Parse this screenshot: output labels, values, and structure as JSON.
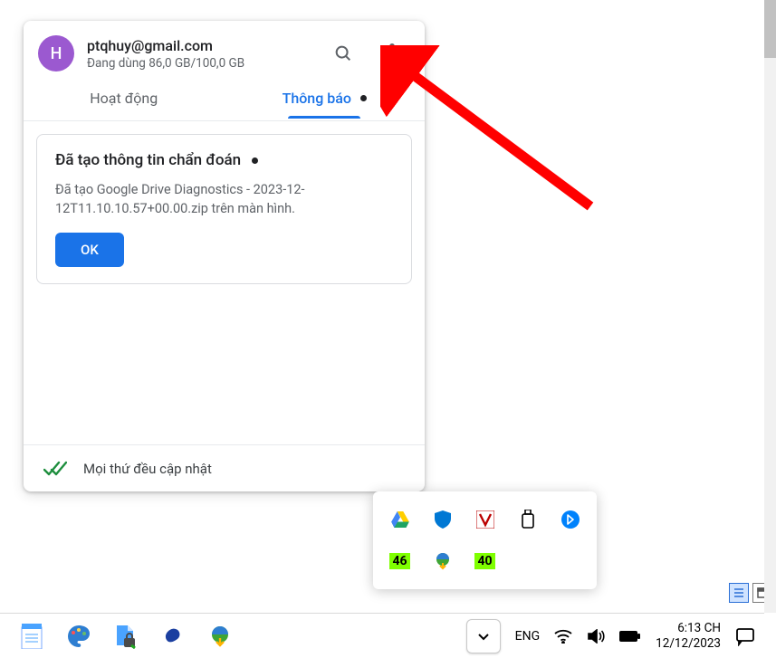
{
  "account": {
    "avatar_letter": "H",
    "email": "ptqhuy@gmail.com",
    "storage": "Đang dùng 86,0 GB/100,0 GB"
  },
  "tabs": {
    "activity": "Hoạt động",
    "notifications": "Thông báo"
  },
  "notification": {
    "title": "Đã tạo thông tin chẩn đoán",
    "body": "Đã tạo Google Drive Diagnostics - 2023-12-12T11.10.10.57+00.00.zip trên màn hình.",
    "ok": "OK"
  },
  "footer": {
    "status": "Mọi thứ đều cập nhật"
  },
  "tray": {
    "badge1": "46",
    "badge2": "40"
  },
  "taskbar": {
    "lang": "ENG",
    "time": "6:13 CH",
    "date": "12/12/2023"
  }
}
